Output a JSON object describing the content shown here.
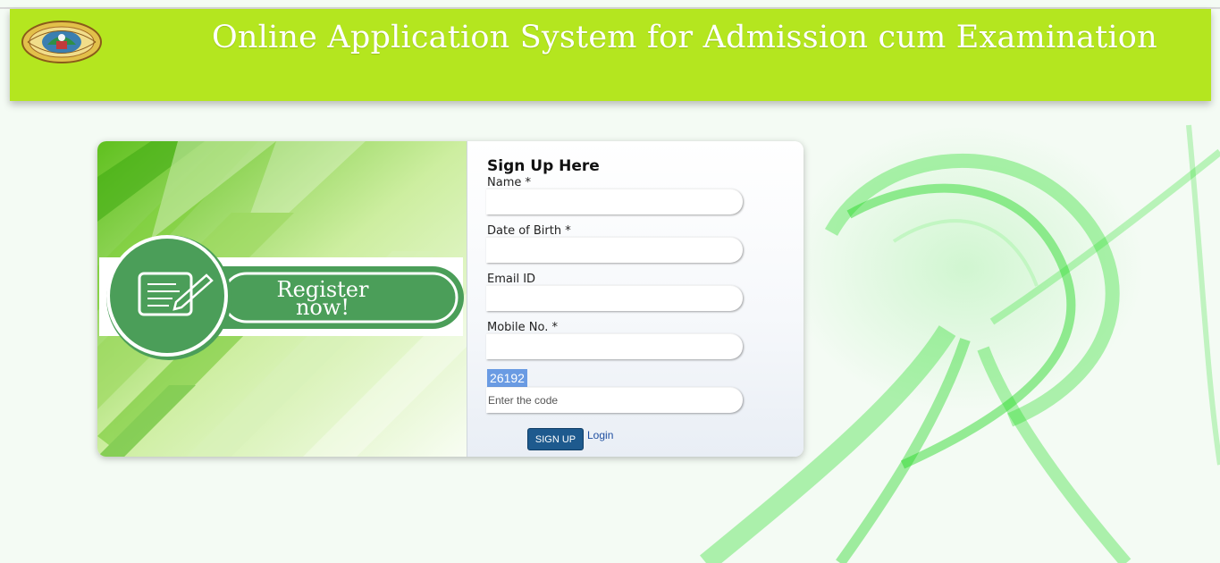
{
  "header": {
    "title": "Online Application System for Admission cum Examination",
    "logo_icon": "university-emblem-icon",
    "background": "#b4e61f"
  },
  "promo": {
    "banner_line1": "Register",
    "banner_line2": "now!",
    "banner_icon": "form-pencil-icon",
    "banner_color": "#4b9e59"
  },
  "form": {
    "title": "Sign Up Here",
    "name_label": "Name *",
    "name_value": "",
    "dob_label": "Date of Birth *",
    "dob_value": "",
    "email_label": "Email ID",
    "email_value": "",
    "mobile_label": "Mobile No. *",
    "mobile_value": "",
    "captcha_code": "26192",
    "captcha_placeholder": "Enter the code",
    "signup_label": "SIGN UP",
    "login_label": "Login"
  },
  "colors": {
    "accent_green": "#b4e61f",
    "button_blue": "#1e5a8e",
    "captcha_highlight": "#6a9be3"
  }
}
